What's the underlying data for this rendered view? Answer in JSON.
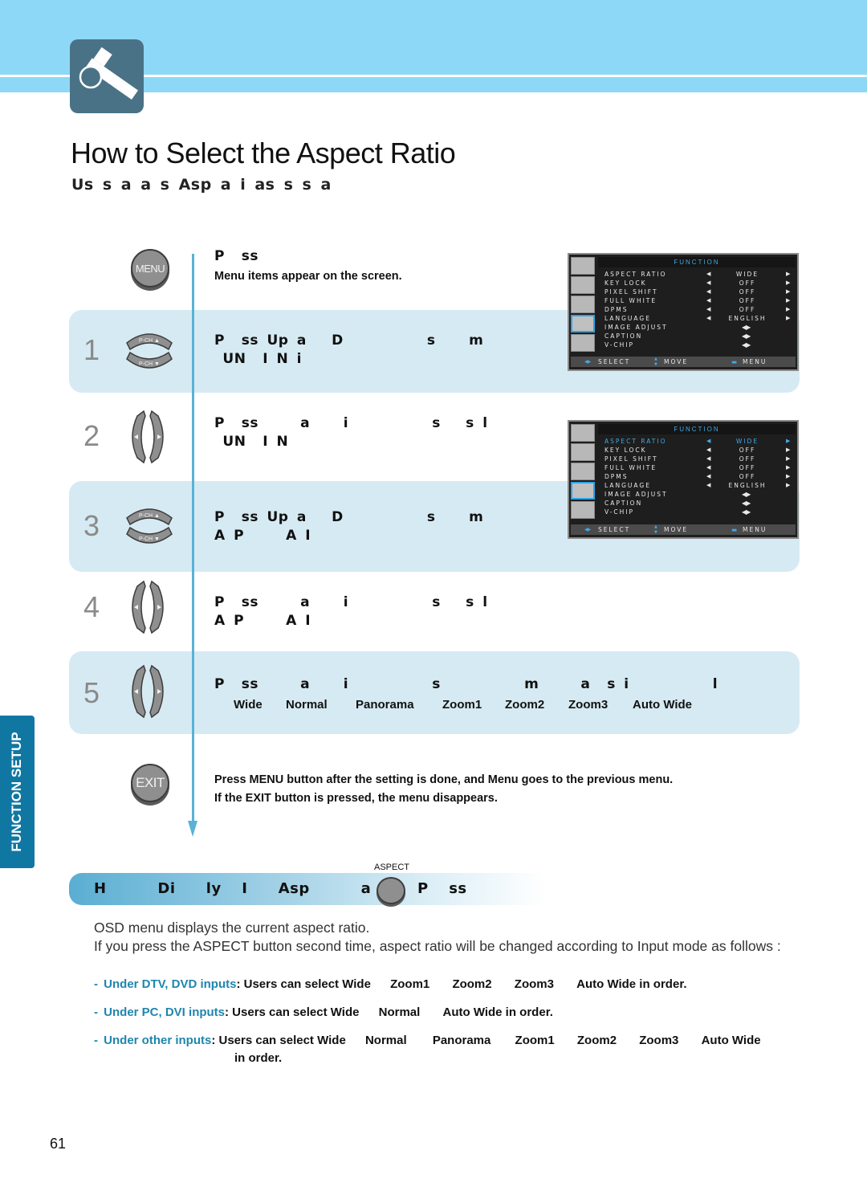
{
  "header": {
    "title": "How to Select the Aspect Ratio",
    "subtitle": "Us s a a s Asp   a i as s s a",
    "section_tab": "FUNCTION SETUP",
    "logo_icon": "wrench-icon"
  },
  "steps": [
    {
      "number": "",
      "button": "MENU",
      "title": "P  ss",
      "subtitle": "Menu items appear on the screen."
    },
    {
      "number": "1",
      "button": "P-CH",
      "button_up": "P-CH ▲",
      "button_down": "P-CH ▼",
      "title": "P  ss Up a   D          s    m",
      "line2": " UN  I N i"
    },
    {
      "number": "2",
      "button": "left-right",
      "title": "P  ss     a    i          s   s l",
      "line2": " UN  I N"
    },
    {
      "number": "3",
      "button": "P-CH",
      "button_up": "P-CH ▲",
      "button_down": "P-CH ▼",
      "title": "P  ss Up a   D          s    m",
      "line2": "A P     A I"
    },
    {
      "number": "4",
      "button": "left-right",
      "title": "P  ss     a    i          s   s l",
      "line2": "A P     A I"
    },
    {
      "number": "5",
      "button": "left-right",
      "title": "P  ss     a    i          s          m     a  s i          l",
      "modes": [
        "Wide",
        "Normal",
        "Panorama",
        "Zoom1",
        "Zoom2",
        "Zoom3",
        "Auto Wide"
      ]
    }
  ],
  "exit": {
    "button": "EXIT",
    "line1": "Press MENU button after the setting is done, and Menu goes to the previous menu.",
    "line2": "If the EXIT button is pressed, the menu disappears."
  },
  "osd": {
    "title": "FUNCTION",
    "rows": [
      {
        "label": "ASPECT RATIO",
        "value": "WIDE",
        "arrows": true
      },
      {
        "label": "KEY LOCK",
        "value": "OFF",
        "arrows": true
      },
      {
        "label": "PIXEL SHIFT",
        "value": "OFF",
        "arrows": true
      },
      {
        "label": "FULL WHITE",
        "value": "OFF",
        "arrows": true
      },
      {
        "label": "DPMS",
        "value": "OFF",
        "arrows": true
      },
      {
        "label": "LANGUAGE",
        "value": "ENGLISH",
        "arrows": true
      },
      {
        "label": "IMAGE ADJUST",
        "value": "◀▶",
        "arrows": false
      },
      {
        "label": "CAPTION",
        "value": "◀▶",
        "arrows": false
      },
      {
        "label": "V-CHIP",
        "value": "◀▶",
        "arrows": false
      }
    ],
    "footer": {
      "select": "SELECT",
      "move": "MOVE",
      "menu": "MENU"
    },
    "screen1_highlight": "none",
    "screen2_highlight": "ASPECT RATIO",
    "left_arrow": "◀",
    "right_arrow": "▶",
    "select_icon": "◀▶",
    "move_icon": "▲▼",
    "menu_icon": "▬"
  },
  "direct": {
    "aspect_label": "ASPECT",
    "bar_title": "H     Di   ly  I   Asp     a i   P  ss",
    "desc1": "OSD menu displays the current aspect ratio.",
    "desc2": "If you press the ASPECT button second time, aspect ratio will be changed according to Input mode as follows :",
    "bullets": [
      {
        "dash": "-",
        "key": "Under DTV, DVD inputs",
        "body": ": Users can select Wide",
        "sequence": [
          "Zoom1",
          "Zoom2",
          "Zoom3",
          "Auto Wide in order."
        ]
      },
      {
        "dash": "-",
        "key": "Under PC, DVI inputs",
        "body": ": Users can select Wide",
        "sequence": [
          "Normal",
          "Auto Wide in order."
        ]
      },
      {
        "dash": "-",
        "key": "Under other inputs",
        "body": ": Users can select Wide",
        "sequence": [
          "Normal",
          "Panorama",
          "Zoom1",
          "Zoom2",
          "Zoom3",
          "Auto Wide"
        ],
        "continuation": "in order."
      }
    ]
  },
  "colors": {
    "banner": "#8ed8f7",
    "band": "#d6eaf3",
    "accent": "#1f86ad",
    "side_tab": "#1077a3",
    "osd_highlight": "#3fa9e6"
  },
  "page_number": "61"
}
